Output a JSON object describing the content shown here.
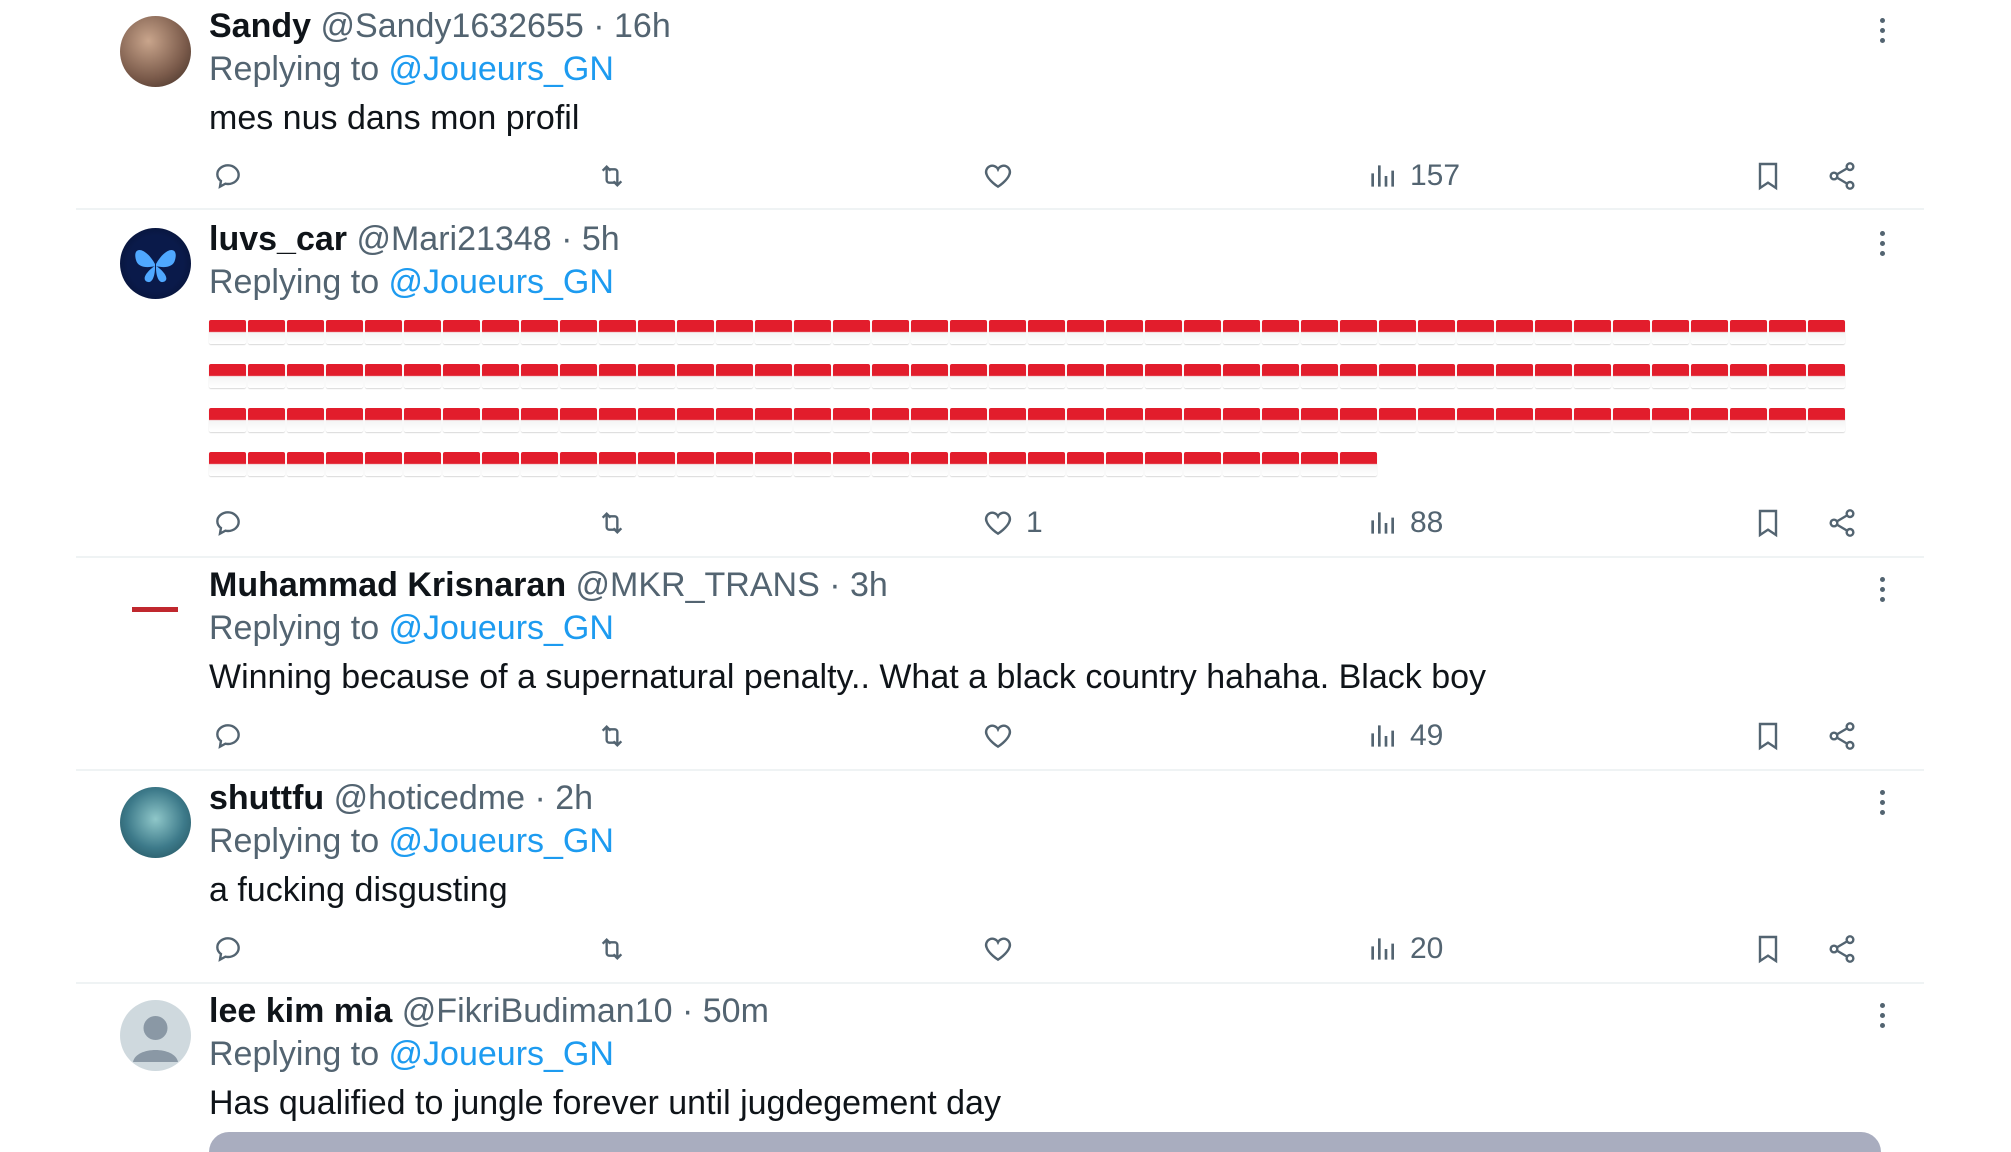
{
  "replies": [
    {
      "name": "Sandy",
      "handle": "@Sandy1632655",
      "time": "· 16h",
      "replying_prefix": "Replying to ",
      "replying_to": "@Joueurs_GN",
      "text": "mes nus dans mon profil",
      "replies_count": "",
      "retweets_count": "",
      "likes_count": "",
      "views": "157",
      "avatar_color": "#7a5a4a"
    },
    {
      "name": "luvs_car",
      "handle": "@Mari21348",
      "time": "· 5h",
      "replying_prefix": "Replying to ",
      "replying_to": "@Joueurs_GN",
      "text": "",
      "flag_emoji_count": 156,
      "replies_count": "",
      "retweets_count": "",
      "likes_count": "1",
      "views": "88",
      "avatar_color": "#0a1a4a"
    },
    {
      "name": "Muhammad Krisnaran",
      "handle": "@MKR_TRANS",
      "time": "· 3h",
      "replying_prefix": "Replying to ",
      "replying_to": "@Joueurs_GN",
      "text": "Winning because of a supernatural penalty.. What a black country hahaha. Black boy",
      "replies_count": "",
      "retweets_count": "",
      "likes_count": "",
      "views": "49",
      "avatar_color": "#ffffff"
    },
    {
      "name": "shuttfu",
      "handle": "@hoticedme",
      "time": "· 2h",
      "replying_prefix": "Replying to ",
      "replying_to": "@Joueurs_GN",
      "text": "a fucking disgusting",
      "replies_count": "",
      "retweets_count": "",
      "likes_count": "",
      "views": "20",
      "avatar_color": "#3d7a8a"
    },
    {
      "name": "lee kim mia",
      "handle": "@FikriBudiman10",
      "time": "· 50m",
      "replying_prefix": "Replying to ",
      "replying_to": "@Joueurs_GN",
      "text": "Has qualified to jungle forever until jugdegement day",
      "avatar_color": "#cfd9de"
    }
  ],
  "colors": {
    "accent": "#1d9bf0",
    "secondary_text": "#536471",
    "primary_text": "#0f1419",
    "divider": "#eff3f4"
  }
}
